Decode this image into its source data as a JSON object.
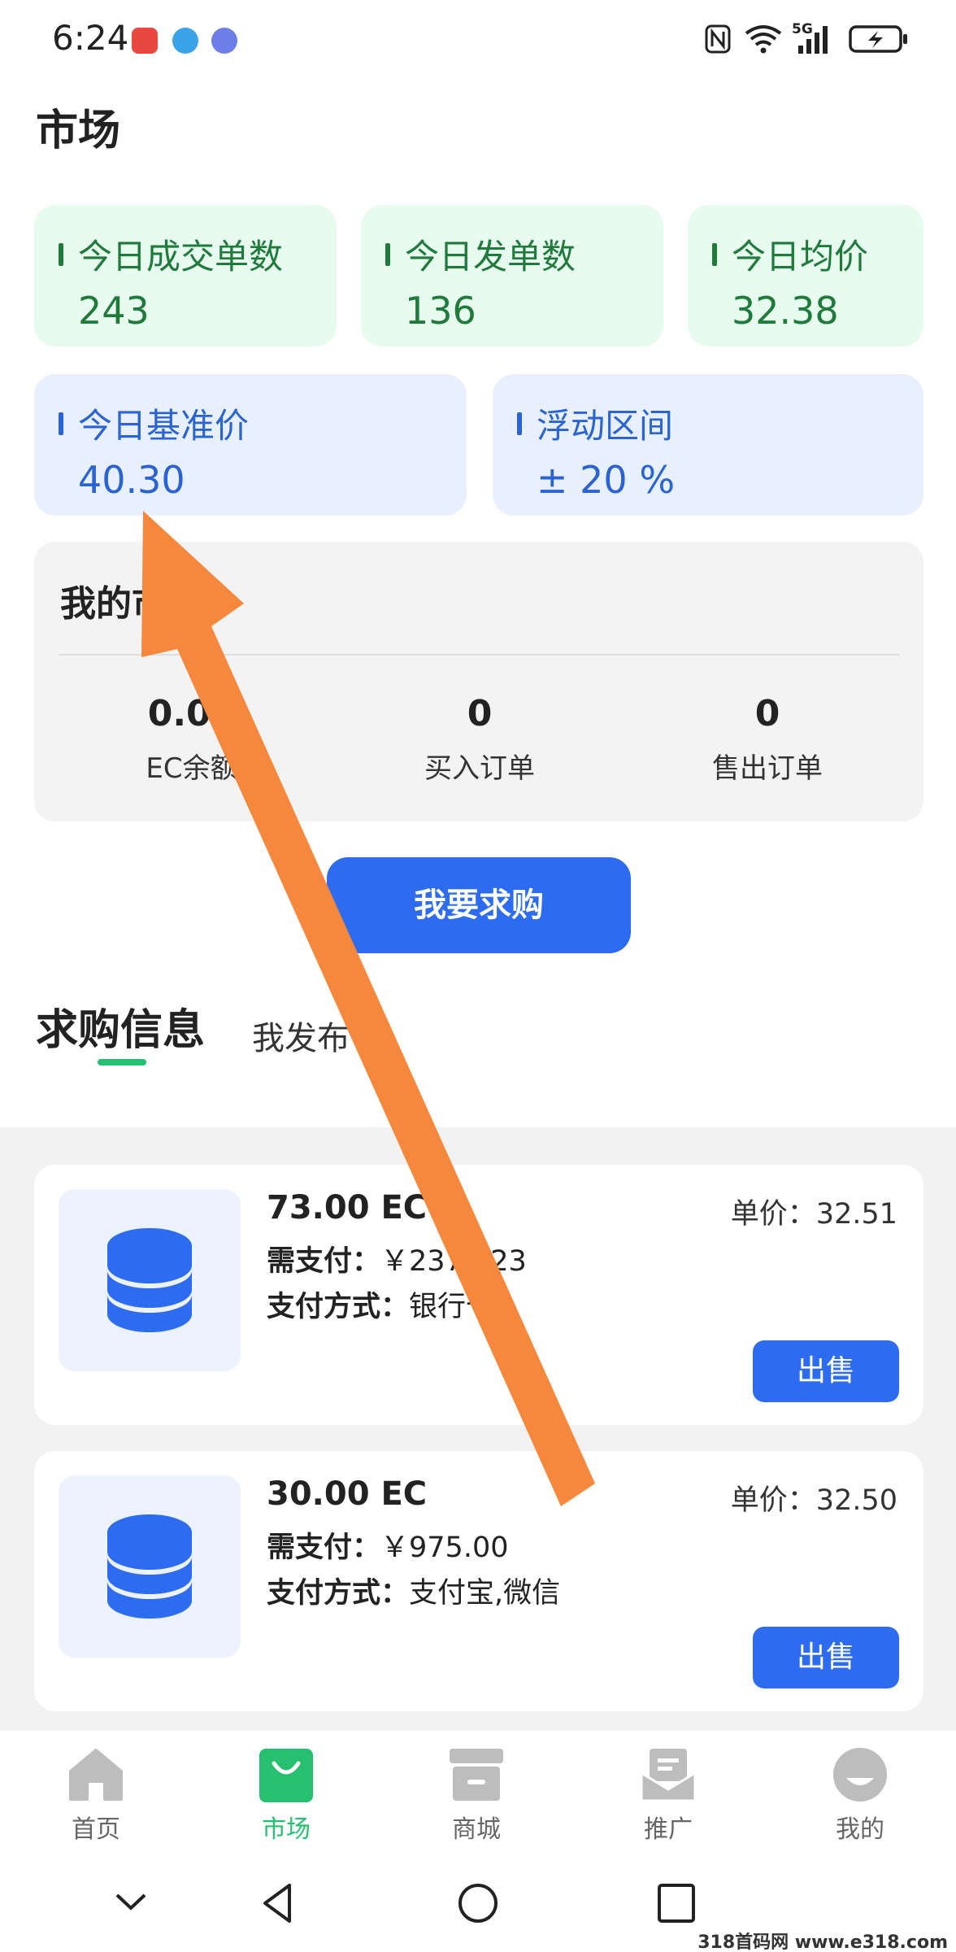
{
  "status_bar": {
    "time": "6:24",
    "network": "5G",
    "icons": [
      "nfc-icon",
      "wifi-icon",
      "signal-icon",
      "battery-charging-icon"
    ],
    "notification_icons": [
      "huawei-app-icon",
      "browser-app-icon",
      "music-app-icon"
    ]
  },
  "page": {
    "title": "市场"
  },
  "stats": {
    "trades_label": "今日成交单数",
    "trades_value": "243",
    "orders_label": "今日发单数",
    "orders_value": "136",
    "avg_label": "今日均价",
    "avg_value": "32.38",
    "base_label": "今日基准价",
    "base_value": "40.30",
    "range_label": "浮动区间",
    "range_value": "± 20 %"
  },
  "my_market": {
    "title": "我的市场",
    "balance_value": "0.00",
    "balance_label": "EC余额",
    "buy_value": "0",
    "buy_label": "买入订单",
    "sell_value": "0",
    "sell_label": "售出订单"
  },
  "buy_button": "我要求购",
  "tabs": {
    "active": "求购信息",
    "other": "我发布"
  },
  "orders": [
    {
      "amount": "73.00 EC",
      "pay_label": "需支付：",
      "pay_value": "￥2373.23",
      "method_label": "支付方式：",
      "method_value": "银行卡",
      "price": "单价：32.51",
      "action": "出售"
    },
    {
      "amount": "30.00 EC",
      "pay_label": "需支付：",
      "pay_value": "￥975.00",
      "method_label": "支付方式：",
      "method_value": "支付宝,微信",
      "price": "单价：32.50",
      "action": "出售"
    }
  ],
  "bottom_nav": {
    "home": "首页",
    "market": "市场",
    "mall": "商城",
    "promote": "推广",
    "mine": "我的",
    "active": "市场"
  },
  "watermark": "318首码网 www.e318.com",
  "colors": {
    "accent_blue": "#2d6cf0",
    "accent_green": "#27c070",
    "stat_green_bg": "#e7fbef",
    "stat_blue_bg": "#e8effd",
    "arrow_orange": "#f5883c"
  }
}
